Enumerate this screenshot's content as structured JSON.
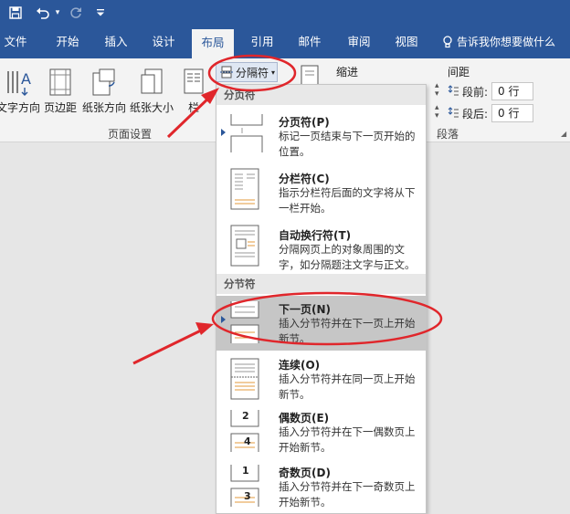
{
  "quick_access": {
    "save_icon": "save-icon",
    "undo_icon": "undo-icon",
    "redo_icon": "redo-icon",
    "customize_icon": "customize-qat-icon"
  },
  "tabs": [
    {
      "label": "文件"
    },
    {
      "label": "开始"
    },
    {
      "label": "插入"
    },
    {
      "label": "设计"
    },
    {
      "label": "布局"
    },
    {
      "label": "引用"
    },
    {
      "label": "邮件"
    },
    {
      "label": "审阅"
    },
    {
      "label": "视图"
    }
  ],
  "tell_me": "告诉我你想要做什么",
  "ribbon": {
    "text_direction": "文字方向",
    "margins": "页边距",
    "orientation": "纸张方向",
    "size": "纸张大小",
    "columns": "栏",
    "page_setup_group": "页面设置",
    "breaks_button": "分隔符",
    "indent": "缩进",
    "spacing": "间距",
    "before_label": "段前:",
    "before_value": "0 行",
    "after_label": "段后:",
    "after_value": "0 行",
    "paragraph_group": "段落"
  },
  "menu": {
    "section_page": "分页符",
    "section_section": "分节符",
    "items": [
      {
        "title": "分页符(P)",
        "desc": "标记一页结束与下一页开始的位置。"
      },
      {
        "title": "分栏符(C)",
        "desc": "指示分栏符后面的文字将从下一栏开始。"
      },
      {
        "title": "自动换行符(T)",
        "desc": "分隔网页上的对象周围的文字，如分隔题注文字与正文。"
      },
      {
        "title": "下一页(N)",
        "desc": "插入分节符并在下一页上开始新节。"
      },
      {
        "title": "连续(O)",
        "desc": "插入分节符并在同一页上开始新节。"
      },
      {
        "title": "偶数页(E)",
        "desc": "插入分节符并在下一偶数页上开始新节。"
      },
      {
        "title": "奇数页(D)",
        "desc": "插入分节符并在下一奇数页上开始新节。"
      }
    ],
    "even_icon_numbers": [
      "2",
      "4"
    ],
    "odd_icon_numbers": [
      "1",
      "3"
    ]
  },
  "colors": {
    "brand": "#2b579a",
    "annotation": "#e0262b"
  }
}
